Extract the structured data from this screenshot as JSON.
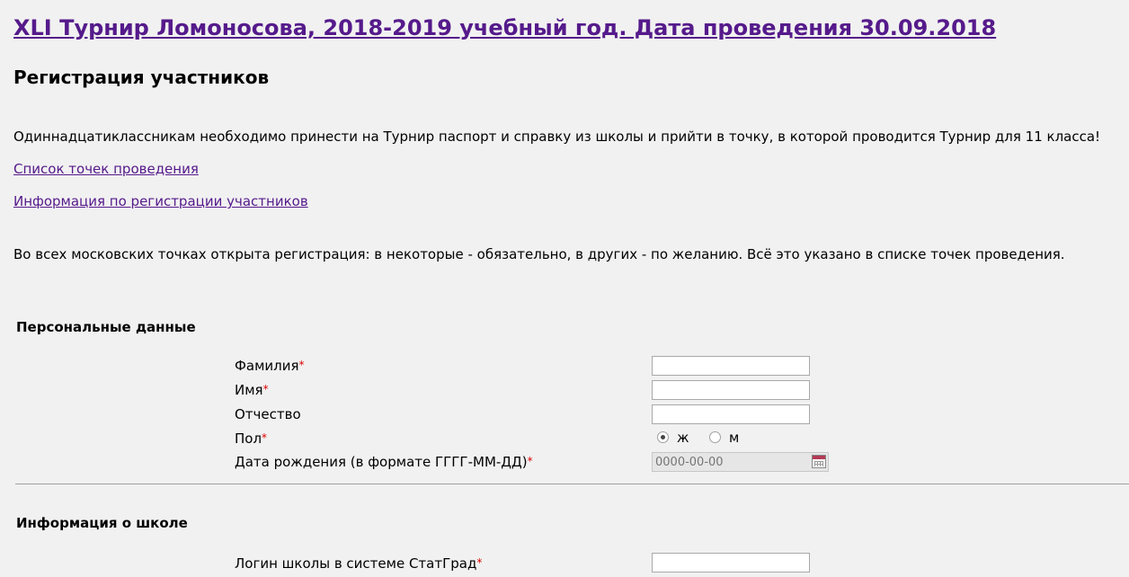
{
  "header": {
    "title": "XLI Турнир Ломоносова, 2018-2019 учебный год. Дата проведения 30.09.2018",
    "subtitle": "Регистрация участников"
  },
  "notice": "Одиннадцатиклассникам необходимо принести на Турнир паспорт и справку из школы и прийти в точку, в которой проводится Турнир для 11 класса!",
  "links": {
    "points_list": "Список точек проведения",
    "registration_info": "Информация по регистрации участников"
  },
  "moscow_note": "Во всех московских точках открыта регистрация: в некоторые - обязательно, в других - по желанию. Всё это указано в списке точек проведения.",
  "required_mark": "*",
  "personal": {
    "heading": "Персональные данные",
    "surname_label": "Фамилия",
    "name_label": "Имя",
    "patronymic_label": "Отчество",
    "gender_label": "Пол",
    "gender_options": [
      "ж",
      "м"
    ],
    "gender_selected": "ж",
    "birthdate_label": "Дата рождения (в формате ГГГГ-ММ-ДД)",
    "birthdate_placeholder": "0000-00-00"
  },
  "school": {
    "heading": "Информация о школе",
    "login_label": "Логин школы в системе СтатГрад"
  },
  "icons": {
    "calendar": "calendar-icon"
  }
}
